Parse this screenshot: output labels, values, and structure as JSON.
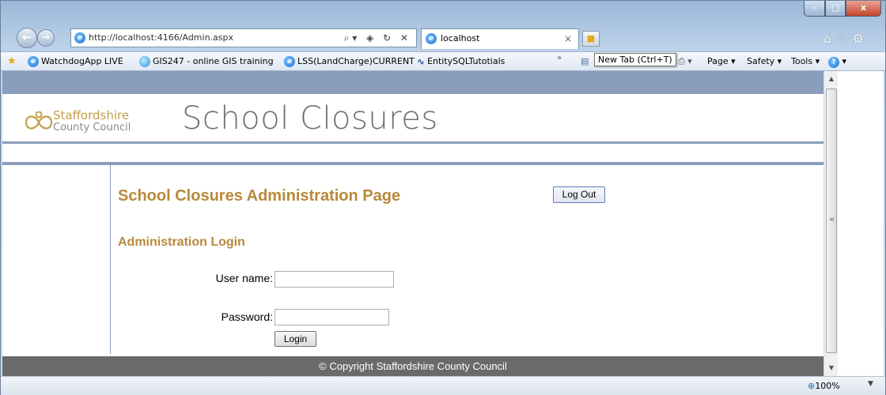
{
  "browser": {
    "window_controls": {
      "minimize": "–",
      "maximize": "▢",
      "close": "x"
    },
    "address": "http://localhost:4166/Admin.aspx",
    "address_controls": "⌕▾ ◈ ↻ ✕",
    "tab_title": "localhost",
    "tab_close": "×",
    "favorites": [
      {
        "label": "WatchdogApp LIVE"
      },
      {
        "label": "GIS247 - online GIS training"
      },
      {
        "label": "LSS(LandCharge)CURRENT"
      },
      {
        "label": "EntitySQLTutotials"
      }
    ],
    "favorites_more": "»",
    "tooltip": "New Tab (Ctrl+T)",
    "commands": [
      {
        "label": "Page ▾"
      },
      {
        "label": "Safety ▾"
      },
      {
        "label": "Tools ▾"
      }
    ],
    "zoom": "100%"
  },
  "page": {
    "logo": {
      "line1": "Staffordshire",
      "line2": "County Council"
    },
    "site_title": "School Closures",
    "admin_title": "School Closures Administration Page",
    "logout_label": "Log Out",
    "login_heading": "Administration Login",
    "username_label": "User name:",
    "username_value": "",
    "password_label": "Password:",
    "password_value": "",
    "login_label": "Login",
    "footer": "© Copyright Staffordshire County Council"
  },
  "colors": {
    "band": "#8a9dbc",
    "heading": "#b8893a",
    "footer_bg": "#6a6a6a"
  }
}
